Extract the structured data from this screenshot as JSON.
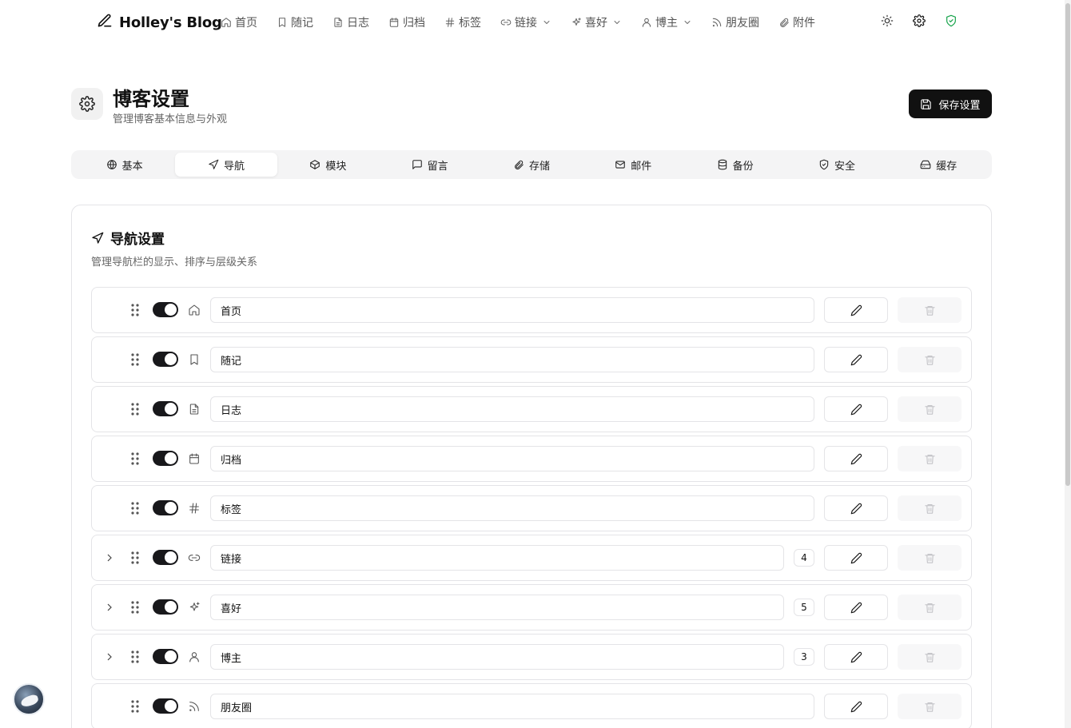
{
  "brand": {
    "name": "Holley's Blog",
    "icon": "pen-icon"
  },
  "nav": {
    "items": [
      {
        "label": "首页",
        "icon": "home-icon",
        "dropdown": false
      },
      {
        "label": "随记",
        "icon": "bookmark-icon",
        "dropdown": false
      },
      {
        "label": "日志",
        "icon": "file-text-icon",
        "dropdown": false
      },
      {
        "label": "归档",
        "icon": "calendar-icon",
        "dropdown": false
      },
      {
        "label": "标签",
        "icon": "hash-icon",
        "dropdown": false
      },
      {
        "label": "链接",
        "icon": "link-icon",
        "dropdown": true
      },
      {
        "label": "喜好",
        "icon": "sparkles-icon",
        "dropdown": true
      },
      {
        "label": "博主",
        "icon": "user-icon",
        "dropdown": true
      },
      {
        "label": "朋友圈",
        "icon": "rss-icon",
        "dropdown": false
      },
      {
        "label": "附件",
        "icon": "paperclip-icon",
        "dropdown": false
      }
    ],
    "tools": [
      "sun-icon",
      "gear-icon",
      "shield-check-icon"
    ],
    "shield_color": "#16a34a"
  },
  "header": {
    "title": "博客设置",
    "subtitle": "管理博客基本信息与外观",
    "save_label": "保存设置"
  },
  "tabs": [
    {
      "label": "基本",
      "icon": "globe-icon",
      "active": false
    },
    {
      "label": "导航",
      "icon": "navigation-icon",
      "active": true
    },
    {
      "label": "模块",
      "icon": "box-icon",
      "active": false
    },
    {
      "label": "留言",
      "icon": "message-icon",
      "active": false
    },
    {
      "label": "存储",
      "icon": "paperclip-icon",
      "active": false
    },
    {
      "label": "邮件",
      "icon": "mail-icon",
      "active": false
    },
    {
      "label": "备份",
      "icon": "database-icon",
      "active": false
    },
    {
      "label": "安全",
      "icon": "shield-check-icon",
      "active": false
    },
    {
      "label": "缓存",
      "icon": "hard-drive-icon",
      "active": false
    }
  ],
  "section": {
    "title": "导航设置",
    "description": "管理导航栏的显示、排序与层级关系"
  },
  "rows": [
    {
      "name": "首页",
      "icon": "home-icon",
      "enabled": true,
      "expandable": false,
      "children": null
    },
    {
      "name": "随记",
      "icon": "bookmark-icon",
      "enabled": true,
      "expandable": false,
      "children": null
    },
    {
      "name": "日志",
      "icon": "file-text-icon",
      "enabled": true,
      "expandable": false,
      "children": null
    },
    {
      "name": "归档",
      "icon": "calendar-icon",
      "enabled": true,
      "expandable": false,
      "children": null
    },
    {
      "name": "标签",
      "icon": "hash-icon",
      "enabled": true,
      "expandable": false,
      "children": null
    },
    {
      "name": "链接",
      "icon": "link-icon",
      "enabled": true,
      "expandable": true,
      "children": "4"
    },
    {
      "name": "喜好",
      "icon": "sparkles-icon",
      "enabled": true,
      "expandable": true,
      "children": "5"
    },
    {
      "name": "博主",
      "icon": "user-icon",
      "enabled": true,
      "expandable": true,
      "children": "3"
    },
    {
      "name": "朋友圈",
      "icon": "rss-icon",
      "enabled": true,
      "expandable": false,
      "children": null
    }
  ]
}
